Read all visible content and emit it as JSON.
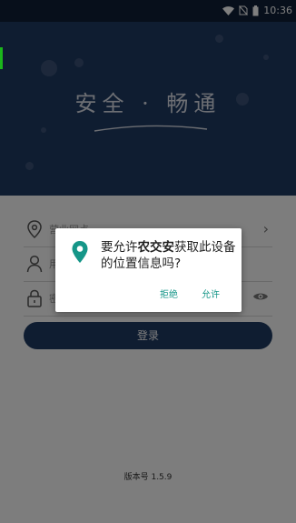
{
  "status_bar": {
    "time": "10:36",
    "icons": [
      "wifi-icon",
      "no-sim-icon",
      "battery-icon"
    ]
  },
  "hero": {
    "slogan": "安全 · 畅通"
  },
  "form": {
    "field_service_hall": {
      "placeholder": "营业网点",
      "icon": "location-pin-icon",
      "trailing": "chevron-right-icon"
    },
    "field_username": {
      "placeholder": "用户名",
      "icon": "user-icon"
    },
    "field_password": {
      "placeholder": "密码",
      "icon": "lock-icon",
      "trailing": "eye-icon"
    },
    "login_label": "登录"
  },
  "version_text": "版本号 1.5.9",
  "dialog": {
    "icon": "location-pin-icon",
    "message_prefix": "要允许",
    "app_name": "农交安",
    "message_suffix": "获取此设备的位置信息吗?",
    "deny_label": "拒绝",
    "allow_label": "允许"
  },
  "colors": {
    "brand_dark": "#1f3a63",
    "dialog_accent": "#159688",
    "overlay": "rgba(0,0,0,0.50)"
  }
}
